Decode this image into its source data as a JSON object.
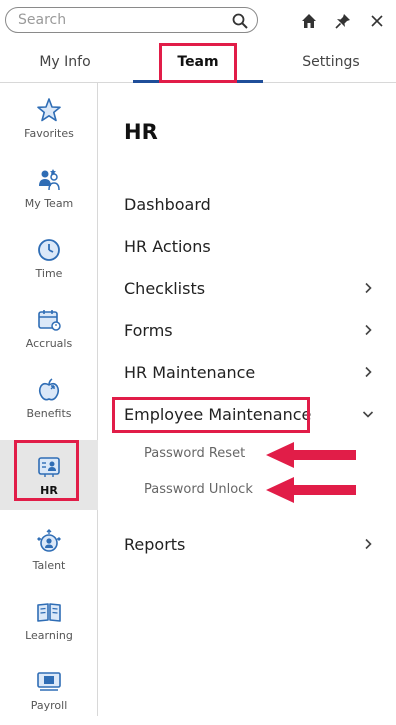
{
  "search": {
    "placeholder": "Search"
  },
  "topbar_icons": [
    "search-icon",
    "home-icon",
    "pin-icon",
    "close-icon"
  ],
  "tabs": [
    {
      "label": "My Info"
    },
    {
      "label": "Team"
    },
    {
      "label": "Settings"
    }
  ],
  "active_tab": "Team",
  "sidebar": {
    "items": [
      {
        "label": "Favorites",
        "icon": "star-icon"
      },
      {
        "label": "My Team",
        "icon": "team-icon"
      },
      {
        "label": "Time",
        "icon": "clock-icon"
      },
      {
        "label": "Accruals",
        "icon": "calendar-icon"
      },
      {
        "label": "Benefits",
        "icon": "apple-icon"
      },
      {
        "label": "HR",
        "icon": "hr-icon"
      },
      {
        "label": "Talent",
        "icon": "talent-icon"
      },
      {
        "label": "Learning",
        "icon": "book-icon"
      },
      {
        "label": "Payroll",
        "icon": "payroll-icon"
      }
    ],
    "active": "HR"
  },
  "main": {
    "title": "HR",
    "menu": [
      {
        "label": "Dashboard"
      },
      {
        "label": "HR Actions"
      },
      {
        "label": "Checklists"
      },
      {
        "label": "Forms"
      },
      {
        "label": "HR Maintenance"
      },
      {
        "label": "Employee Maintenance"
      },
      {
        "label": "Reports"
      }
    ],
    "submenu": [
      {
        "label": "Password Reset"
      },
      {
        "label": "Password Unlock"
      }
    ]
  },
  "colors": {
    "accent": "#1f4e99",
    "highlight": "#e11d48",
    "icon_blue": "#2f6db5"
  }
}
